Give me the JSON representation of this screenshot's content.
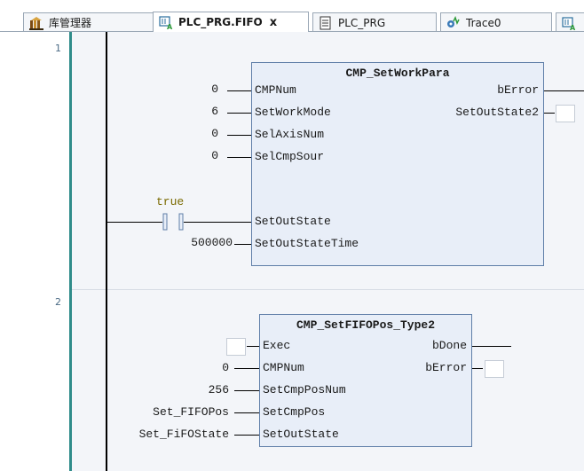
{
  "tabs": [
    {
      "label": "库管理器",
      "icon": "library-icon"
    },
    {
      "label": "PLC_PRG.FIFO",
      "icon": "fbd-icon",
      "active": true,
      "close": "x"
    },
    {
      "label": "PLC_PRG",
      "icon": "document-icon"
    },
    {
      "label": "Trace0",
      "icon": "trace-icon"
    },
    {
      "label": "",
      "icon": "fbd-icon"
    }
  ],
  "networks": [
    {
      "number": "1",
      "block": {
        "title": "CMP_SetWorkPara",
        "inputs": [
          "CMPNum",
          "SetWorkMode",
          "SelAxisNum",
          "SelCmpSour",
          "SetOutState",
          "SetOutStateTime"
        ],
        "outputs": [
          "bError",
          "SetOutState2"
        ],
        "input_values": [
          "0",
          "6",
          "0",
          "0",
          "",
          "500000"
        ],
        "contact_label": "true"
      }
    },
    {
      "number": "2",
      "block": {
        "title": "CMP_SetFIFOPos_Type2",
        "inputs": [
          "Exec",
          "CMPNum",
          "SetCmpPosNum",
          "SetCmpPos",
          "SetOutState"
        ],
        "outputs": [
          "bDone",
          "bError"
        ],
        "input_values": [
          "",
          "0",
          "256",
          "Set_FIFOPos",
          "Set_FiFOState"
        ]
      }
    }
  ],
  "colors": {
    "accent_bar": "#2f8c8a",
    "block_fill": "#e8eef8",
    "block_border": "#5f7ea8",
    "contact_label": "#7a6a00"
  }
}
